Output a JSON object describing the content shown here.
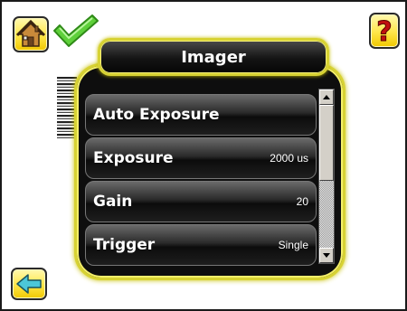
{
  "header": {
    "title": "Imager",
    "home_icon": "home-icon",
    "status_icon": "check-icon",
    "help_icon": "help-icon",
    "back_icon": "back-arrow-icon"
  },
  "menu": {
    "items": [
      {
        "label": "Auto Exposure",
        "value": ""
      },
      {
        "label": "Exposure",
        "value": "2000 us"
      },
      {
        "label": "Gain",
        "value": "20"
      },
      {
        "label": "Trigger",
        "value": "Single"
      }
    ]
  },
  "colors": {
    "accent_yellow": "#d7d233",
    "check_green": "#5ed03a",
    "panel_black": "#0e0e0e"
  }
}
